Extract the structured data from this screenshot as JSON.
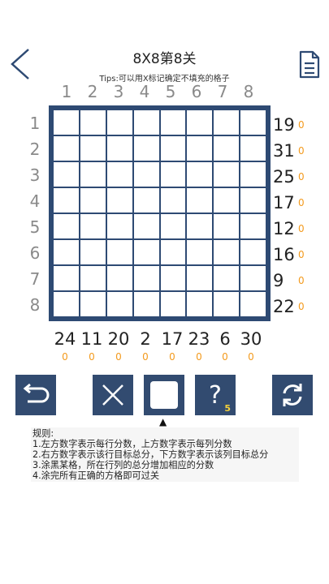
{
  "header": {
    "title": "8X8第8关",
    "tips": "Tips:可以用X标记确定不填充的格子",
    "back_icon": "chevron-left-icon",
    "doc_icon": "document-icon"
  },
  "col_numbers": [
    "1",
    "2",
    "3",
    "4",
    "5",
    "6",
    "7",
    "8"
  ],
  "row_numbers": [
    "1",
    "2",
    "3",
    "4",
    "5",
    "6",
    "7",
    "8"
  ],
  "row_targets": [
    "19",
    "31",
    "25",
    "17",
    "12",
    "16",
    "9",
    "22"
  ],
  "row_scores": [
    "0",
    "0",
    "0",
    "0",
    "0",
    "0",
    "0",
    "0"
  ],
  "col_targets": [
    "24",
    "11",
    "20",
    "2",
    "17",
    "23",
    "6",
    "30"
  ],
  "col_scores": [
    "0",
    "0",
    "0",
    "0",
    "0",
    "0",
    "0",
    "0"
  ],
  "toolbar": {
    "undo_icon": "undo-icon",
    "mark_x_icon": "x-mark-icon",
    "fill_icon": "fill-square-icon",
    "hint_label": "?",
    "hint_count": "5",
    "restart_icon": "refresh-icon",
    "selected_marker": "▲"
  },
  "rules": {
    "heading": "规则:",
    "lines": [
      "1.左方数字表示每行分数，上方数字表示每列分数",
      "2.右方数字表示该行目标总分，下方数字表示该列目标总分",
      "3.涂黑某格，所在行列的总分增加相应的分数",
      "4.涂完所有正确的方格即可过关"
    ]
  },
  "colors": {
    "board": "#2e4a73",
    "tool_bg": "#324b70",
    "score": "#f39a1d",
    "hint_badge": "#f5d23a"
  }
}
